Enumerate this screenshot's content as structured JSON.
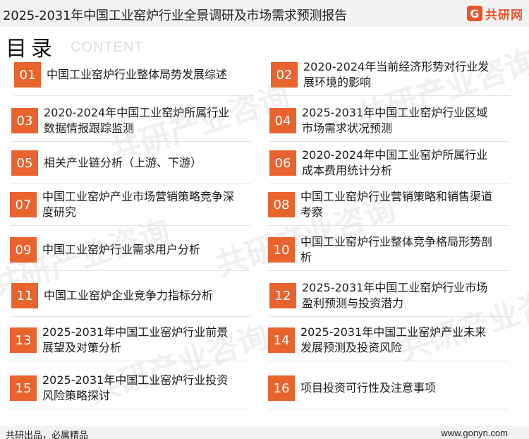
{
  "header": {
    "title": "2025-2031年中国工业窑炉行业全景调研及市场需求预测报告",
    "logo_text": "共研网",
    "logo_mark": "G",
    "accent": "#e8542b"
  },
  "section": {
    "title": "目录",
    "subtitle": "CONTENT"
  },
  "watermark": "共研产业咨询",
  "toc": [
    {
      "num": "01",
      "label": "中国工业窑炉行业整体局势发展综述"
    },
    {
      "num": "02",
      "label": "2020-2024年当前经济形势对行业发展环境的影响"
    },
    {
      "num": "03",
      "label": "2020-2024年中国工业窑炉所属行业数据情报跟踪监测"
    },
    {
      "num": "04",
      "label": "2025-2031年中国工业窑炉行业区域市场需求状况预测"
    },
    {
      "num": "05",
      "label": "相关产业链分析（上游、下游）"
    },
    {
      "num": "06",
      "label": "2020-2024年中国工业窑炉所属行业成本费用统计分析"
    },
    {
      "num": "07",
      "label": "中国工业窑炉产业市场营销策略竞争深度研究"
    },
    {
      "num": "08",
      "label": "中国工业窑炉行业营销策略和销售渠道考察"
    },
    {
      "num": "09",
      "label": "中国工业窑炉行业需求用户分析"
    },
    {
      "num": "10",
      "label": "中国工业窑炉行业整体竞争格局形势剖析"
    },
    {
      "num": "11",
      "label": "中国工业窑炉企业竞争力指标分析"
    },
    {
      "num": "12",
      "label": "2025-2031年中国工业窑炉行业市场盈利预测与投资潜力"
    },
    {
      "num": "13",
      "label": "2025-2031年中国工业窑炉行业前景展望及对策分析"
    },
    {
      "num": "14",
      "label": "2025-2031年中国工业窑炉产业未来发展预测及投资风险"
    },
    {
      "num": "15",
      "label": "2025-2031年中国工业窑炉行业投资风险策略探讨"
    },
    {
      "num": "16",
      "label": "项目投资可行性及注意事项"
    }
  ],
  "footer": {
    "left": "共研出品，必属精品",
    "right": "www.gonyn.com"
  }
}
